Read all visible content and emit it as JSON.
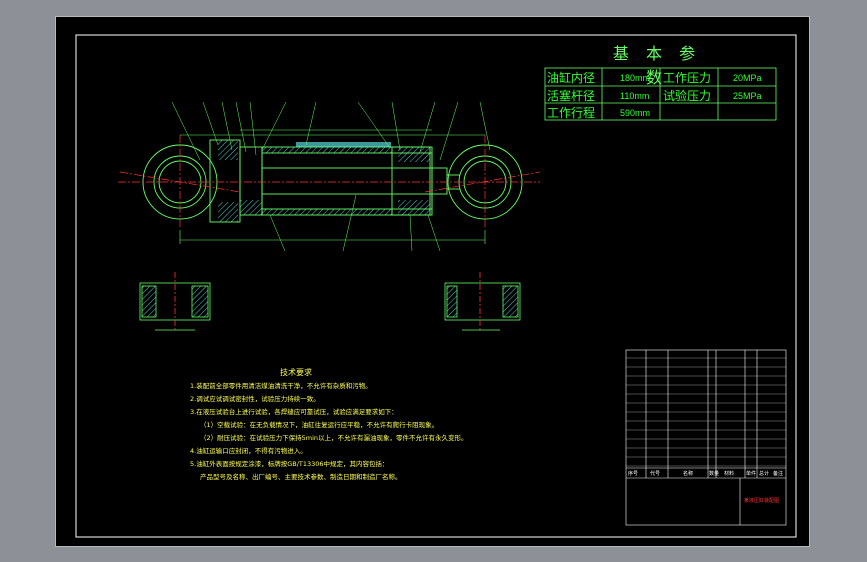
{
  "params": {
    "title": "基 本 参 数",
    "rows": [
      {
        "label1": "油缸内径",
        "value1": "180mm",
        "label2": "工作压力",
        "value2": "20MPa"
      },
      {
        "label1": "活塞杆径",
        "value1": "110mm",
        "label2": "试验压力",
        "value2": "25MPa"
      },
      {
        "label1": "工作行程",
        "value1": "590mm",
        "label2": "",
        "value2": ""
      }
    ]
  },
  "tech": {
    "title": "技术要求",
    "lines": [
      "1.装配前全部零件用清洁煤油清洗干净，不允许有杂质和污物。",
      "2.调试应试调试密封性，试验压力持续一致。",
      "3.在液压试验台上进行试验，各焊缝应可靠试压，试验应满足要求如下：",
      "（1）空载试验：在无负载情况下，油缸往复运行应平稳，不允许有爬行卡阻现象。",
      "（2）耐压试验：在试验压力下保持5min以上，不允许有漏油现象，零件不允许有永久变形。",
      "4.油缸运输口应封闭，不得有污物进入。",
      "5.油缸外表面按规定涂漆，标牌按GB/T13306中规定，其内容包括：",
      "产品型号及名称、出厂编号、主要技术参数、制造日期和制造厂名称。"
    ]
  },
  "title_block": {
    "header": [
      "序号",
      "代号",
      "名称",
      "数量",
      "材料",
      "单件",
      "总计",
      "备注"
    ],
    "drawing_name": "某液压缸装配图"
  },
  "colors": {
    "background": "#8d9097",
    "sheet": "#000000",
    "outline": "#66ff66",
    "centerline": "#ff3333",
    "text": "#ffff55",
    "hatch": "#66ffff"
  }
}
